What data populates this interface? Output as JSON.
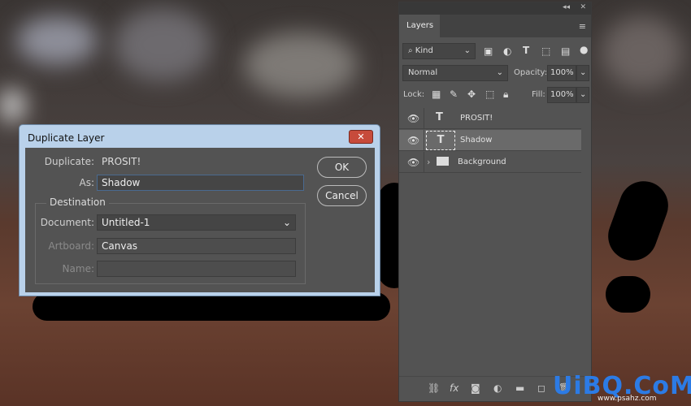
{
  "layers_panel": {
    "title": "Layers",
    "filter_kind": "Kind",
    "blend_mode": "Normal",
    "opacity_label": "Opacity:",
    "opacity": "100%",
    "lock_label": "Lock:",
    "fill_label": "Fill:",
    "fill": "100%",
    "layers": [
      {
        "name": "PROSIT!",
        "type": "text",
        "visible": true,
        "selected": false
      },
      {
        "name": "Shadow",
        "type": "text",
        "visible": true,
        "selected": true
      },
      {
        "name": "Background",
        "type": "group",
        "visible": true,
        "selected": false
      }
    ]
  },
  "dialog": {
    "title": "Duplicate Layer",
    "duplicate_label": "Duplicate:",
    "duplicate_value": "PROSIT!",
    "as_label": "As:",
    "as_value": "Shadow",
    "ok": "OK",
    "cancel": "Cancel",
    "destination": "Destination",
    "document_label": "Document:",
    "document_value": "Untitled-1",
    "artboard_label": "Artboard:",
    "artboard_value": "Canvas",
    "name_label": "Name:",
    "name_value": ""
  },
  "watermark": {
    "logo": "UiBQ.CoM",
    "url": "www.psahz.com"
  }
}
